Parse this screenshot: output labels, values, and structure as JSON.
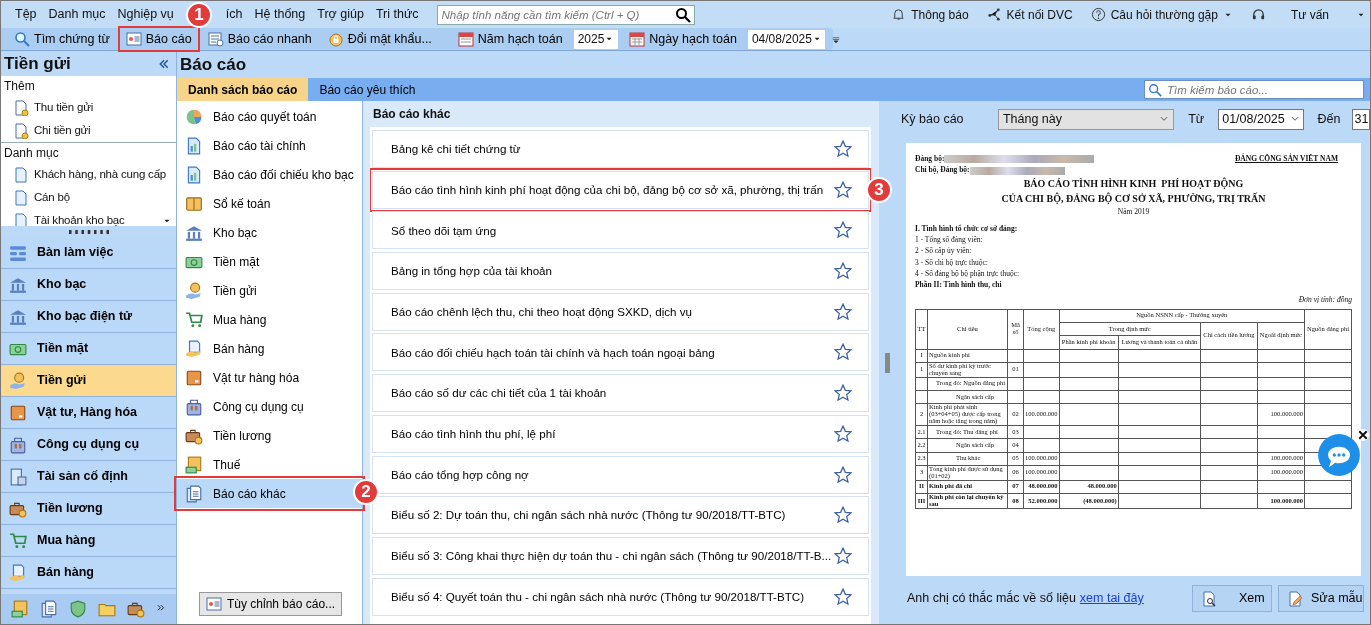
{
  "menu": [
    {
      "label": "Tệp"
    },
    {
      "label": "Danh mục"
    },
    {
      "label": "Nghiệp vụ"
    },
    {
      "label": "ích"
    },
    {
      "label": "Hệ thống"
    },
    {
      "label": "Trợ giúp"
    },
    {
      "label": "Tri thức"
    }
  ],
  "search": {
    "placeholder": "Nhập tính năng cần tìm kiếm (Ctrl + Q)"
  },
  "top_links": [
    {
      "label": "Thông báo"
    },
    {
      "label": "Kết nối DVC"
    },
    {
      "label": "Câu hỏi thường gặp",
      "dropdown": true
    },
    {
      "label": "Tư vấn",
      "dropdown": true
    }
  ],
  "toolbar": [
    {
      "kind": "button",
      "label": "Tìm chứng từ"
    },
    {
      "kind": "button",
      "label": "Báo cáo",
      "callout": "1"
    },
    {
      "kind": "button",
      "label": "Báo cáo nhanh"
    },
    {
      "kind": "button",
      "label": "Đổi mật khẩu..."
    },
    {
      "kind": "select",
      "label": "Năm hạch toán",
      "value": "2025"
    },
    {
      "kind": "select",
      "label": "Ngày hạch toán",
      "value": "04/08/2025"
    }
  ],
  "sidebar": {
    "title": "Tiền gửi",
    "sections": [
      {
        "heading": "Thêm",
        "items": [
          "Thu tiền gửi",
          "Chi tiền gửi"
        ]
      },
      {
        "heading": "Danh mục",
        "items": [
          "Khách hàng, nhà cung cấp",
          "Cán bộ",
          "Tài khoản kho bạc"
        ]
      }
    ],
    "modules": [
      {
        "label": "Bàn làm việc",
        "selected": false
      },
      {
        "label": "Kho bạc",
        "selected": false
      },
      {
        "label": "Kho bạc điện tử",
        "selected": false
      },
      {
        "label": "Tiền mặt",
        "selected": false
      },
      {
        "label": "Tiền gửi",
        "selected": true
      },
      {
        "label": "Vật tư, Hàng hóa",
        "selected": false
      },
      {
        "label": "Công cụ dụng cụ",
        "selected": false
      },
      {
        "label": "Tài sản cố định",
        "selected": false
      },
      {
        "label": "Tiền lương",
        "selected": false
      },
      {
        "label": "Mua hàng",
        "selected": false
      },
      {
        "label": "Bán hàng",
        "selected": false
      }
    ]
  },
  "page_title": "Báo cáo",
  "tabs": [
    {
      "label": "Danh sách báo cáo",
      "selected": true
    },
    {
      "label": "Báo cáo yêu thích",
      "selected": false
    }
  ],
  "report_search": {
    "placeholder": "Tìm kiếm báo cáo..."
  },
  "categories": [
    {
      "label": "Báo cáo quyết toán",
      "selected": false
    },
    {
      "label": "Báo cáo tài chính",
      "selected": false
    },
    {
      "label": "Báo cáo đối chiếu kho bạc",
      "selected": false
    },
    {
      "label": "Sổ kế toán",
      "selected": false
    },
    {
      "label": "Kho bạc",
      "selected": false
    },
    {
      "label": "Tiền mặt",
      "selected": false
    },
    {
      "label": "Tiền gửi",
      "selected": false
    },
    {
      "label": "Mua hàng",
      "selected": false
    },
    {
      "label": "Bán hàng",
      "selected": false
    },
    {
      "label": "Vật tư hàng hóa",
      "selected": false
    },
    {
      "label": "Công cụ dụng cụ",
      "selected": false
    },
    {
      "label": "Tiền lương",
      "selected": false
    },
    {
      "label": "Thuế",
      "selected": false
    },
    {
      "label": "Báo cáo khác",
      "selected": true,
      "callout": "2"
    }
  ],
  "customize_button": "Tùy chỉnh báo cáo...",
  "reports": {
    "heading": "Báo cáo khác",
    "items": [
      {
        "label": "Bảng kê chi tiết chứng từ",
        "favorite": false
      },
      {
        "label": "Báo cáo tình hình kinh phí hoạt động của chi bộ, đảng bộ cơ sở xã, phường, thị trấn",
        "favorite": false,
        "callout": "3"
      },
      {
        "label": "Sổ theo dõi tạm ứng",
        "favorite": false
      },
      {
        "label": "Bảng in tổng hợp của tài khoản",
        "favorite": false
      },
      {
        "label": "Báo cáo chênh lệch thu, chi theo hoạt động SXKD, dịch vụ",
        "favorite": false
      },
      {
        "label": "Báo cáo đối chiếu hạch toán tài chính và hạch toán ngoại bảng",
        "favorite": false
      },
      {
        "label": "Báo cáo số dư các chi tiết của 1 tài khoản",
        "favorite": false
      },
      {
        "label": "Báo cáo tình hình thu phí, lệ phí",
        "favorite": false
      },
      {
        "label": "Báo cáo tổng hợp công nợ",
        "favorite": false
      },
      {
        "label": "Biểu số 2: Dự toán thu, chi ngân sách nhà nước (Thông tư 90/2018/TT-BTC)",
        "favorite": false
      },
      {
        "label": "Biểu số 3: Công khai thực hiện dự toán thu - chi ngân sách (Thông tư 90/2018/TT-B...",
        "favorite": false
      },
      {
        "label": "Biểu số 4: Quyết toán thu - chi ngân sách nhà nước (Thông tư 90/2018/TT-BTC)",
        "favorite": false
      }
    ]
  },
  "preview": {
    "period_label": "Kỳ báo cáo",
    "period": "Tháng này",
    "from_label": "Từ",
    "from": "01/08/2025",
    "to_label": "Đến",
    "to": "31",
    "document": {
      "org_label": "Đảng bộ:",
      "branch_label": "Chi bộ, Đảng bộ:",
      "party": "ĐẢNG CỘNG SẢN VIỆT NAM",
      "title_lines": [
        "BÁO CÁO TÌNH HÌNH KINH  PHÍ HOẠT ĐỘNG",
        "CỦA CHI BỘ, ĐẢNG BỘ CƠ SỞ XÃ, PHƯỜNG, TRỊ TRẤN"
      ],
      "year": "Năm 2019",
      "section_1": "I. Tình hình tổ chức cơ sở đảng:",
      "section_1_lines": [
        "1 - Tổng số đảng viên:",
        "2 - Số cấp ủy viên:",
        "3 - Số chi bộ trực thuộc:",
        "4 - Số đảng bộ bộ phận trực thuộc:"
      ],
      "section_2": "Phần II: Tình hình thu, chi",
      "unit": "Đơn vị tính: đồng",
      "table": {
        "group_header": "Nguồn NSNN cấp - Thường xuyên",
        "subgroup_header": "Trong định mức",
        "columns": [
          "TT",
          "Chỉ tiêu",
          "Mã số",
          "Tổng cộng",
          "Phần kinh phí khoán",
          "Lương và thanh toán cá nhân",
          "Chi cách tiền lương",
          "Ngoài định mức",
          "Nguồn đảng phí"
        ],
        "rows": [
          {
            "kind": "main",
            "bold": false,
            "tt": "I",
            "label": "Nguồn kinh phí"
          },
          {
            "kind": "main",
            "bold": false,
            "tt": "1",
            "label": "Số dư kinh phí kỳ trước chuyển sang",
            "code": "01"
          },
          {
            "kind": "sub",
            "bold": false,
            "label": "Trong đó: Nguồn đảng phí"
          },
          {
            "kind": "subsub",
            "bold": false,
            "label": "Ngân sách cấp"
          },
          {
            "kind": "main",
            "bold": false,
            "tt": "2",
            "label": "Kinh phí phát sinh (03+04+05) được cấp trong năm hoặc tăng trong năm)",
            "code": "02",
            "total": "100.000.000",
            "outside": "100.000.000"
          },
          {
            "kind": "sub",
            "bold": false,
            "tt": "2.1",
            "label": "Trong đó: Thu đảng phí",
            "code": "03"
          },
          {
            "kind": "subsub",
            "bold": false,
            "tt": "2.2",
            "label": "Ngân sách cấp",
            "code": "04"
          },
          {
            "kind": "subsub",
            "bold": false,
            "tt": "2.3",
            "label": "Thu khác",
            "code": "05",
            "total": "100.000.000",
            "outside": "100.000.000"
          },
          {
            "kind": "main",
            "bold": false,
            "tt": "3",
            "label": "Tổng kinh phí được sử dụng (01+02)",
            "code": "06",
            "total": "100.000.000",
            "outside": "100.000.000"
          },
          {
            "kind": "main",
            "bold": true,
            "tt": "II",
            "label": "Kinh phí đã chi",
            "code": "07",
            "total": "48.000.000",
            "contract": "48.000.000"
          },
          {
            "kind": "main",
            "bold": true,
            "tt": "III",
            "label": "Kinh phí còn lại chuyển kỳ sau",
            "code": "08",
            "total": "52.000.000",
            "contract": "(48.000.000)",
            "outside": "100.000.000"
          }
        ]
      }
    },
    "question": "Anh chị có thắc mắc về số liệu",
    "link": "xem tai đây",
    "buttons": [
      "Xem",
      "Sửa mẫu"
    ]
  }
}
